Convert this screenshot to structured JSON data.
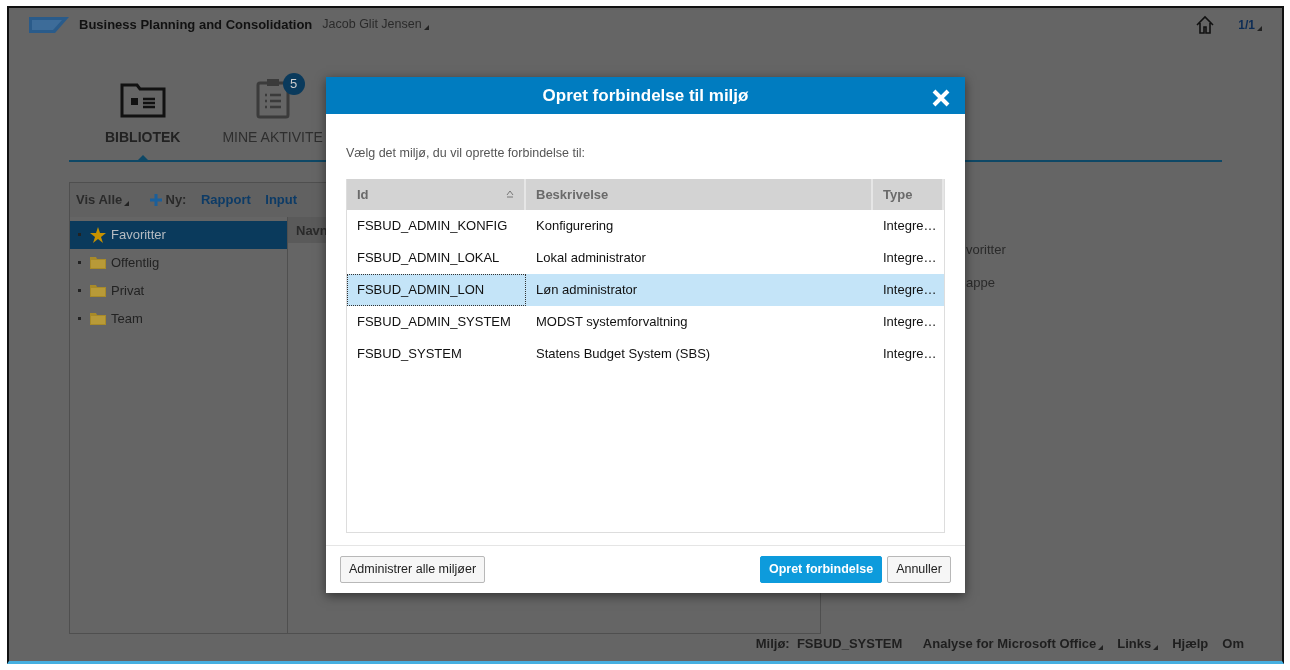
{
  "header": {
    "title": "Business Planning and Consolidation",
    "user": "Jacob Glit Jensen",
    "page": "1/1"
  },
  "tabs": [
    {
      "label": "BIBLIOTEK",
      "selected": true
    },
    {
      "label": "MINE AKTIVITE",
      "selected": false,
      "badge": "5"
    }
  ],
  "toolbar": {
    "filter": "Vis Alle",
    "new_label": "Ny:",
    "links": [
      "Rapport",
      "Input"
    ]
  },
  "tree": [
    {
      "label": "Favoritter",
      "kind": "star",
      "selected": true
    },
    {
      "label": "Offentlig",
      "kind": "folder",
      "selected": false
    },
    {
      "label": "Privat",
      "kind": "folder",
      "selected": false
    },
    {
      "label": "Team",
      "kind": "folder",
      "selected": false
    }
  ],
  "list_column": "Navn",
  "side_texts": [
    "voritter",
    "appe"
  ],
  "footer": {
    "env_label": "Miljø:",
    "env_value": "FSBUD_SYSTEM",
    "links": [
      {
        "label": "Analyse for Microsoft Office",
        "dropdown": true
      },
      {
        "label": "Links",
        "dropdown": true
      },
      {
        "label": "Hjælp",
        "dropdown": false
      },
      {
        "label": "Om",
        "dropdown": false
      }
    ]
  },
  "dialog": {
    "title": "Opret forbindelse til miljø",
    "instruction": "Vælg det miljø, du vil oprette forbindelse til:",
    "columns": [
      "Id",
      "Beskrivelse",
      "Type"
    ],
    "rows": [
      {
        "id": "FSBUD_ADMIN_KONFIG",
        "description": "Konfigurering",
        "type": "Integre…",
        "selected": false
      },
      {
        "id": "FSBUD_ADMIN_LOKAL",
        "description": "Lokal administrator",
        "type": "Integre…",
        "selected": false
      },
      {
        "id": "FSBUD_ADMIN_LON",
        "description": "Løn administrator",
        "type": "Integre…",
        "selected": true
      },
      {
        "id": "FSBUD_ADMIN_SYSTEM",
        "description": "MODST systemforvaltning",
        "type": "Integre…",
        "selected": false
      },
      {
        "id": "FSBUD_SYSTEM",
        "description": "Statens Budget System (SBS)",
        "type": "Integre…",
        "selected": false
      }
    ],
    "manage_button": "Administrer alle miljøer",
    "primary_button": "Opret forbindelse",
    "cancel_button": "Annuller"
  }
}
